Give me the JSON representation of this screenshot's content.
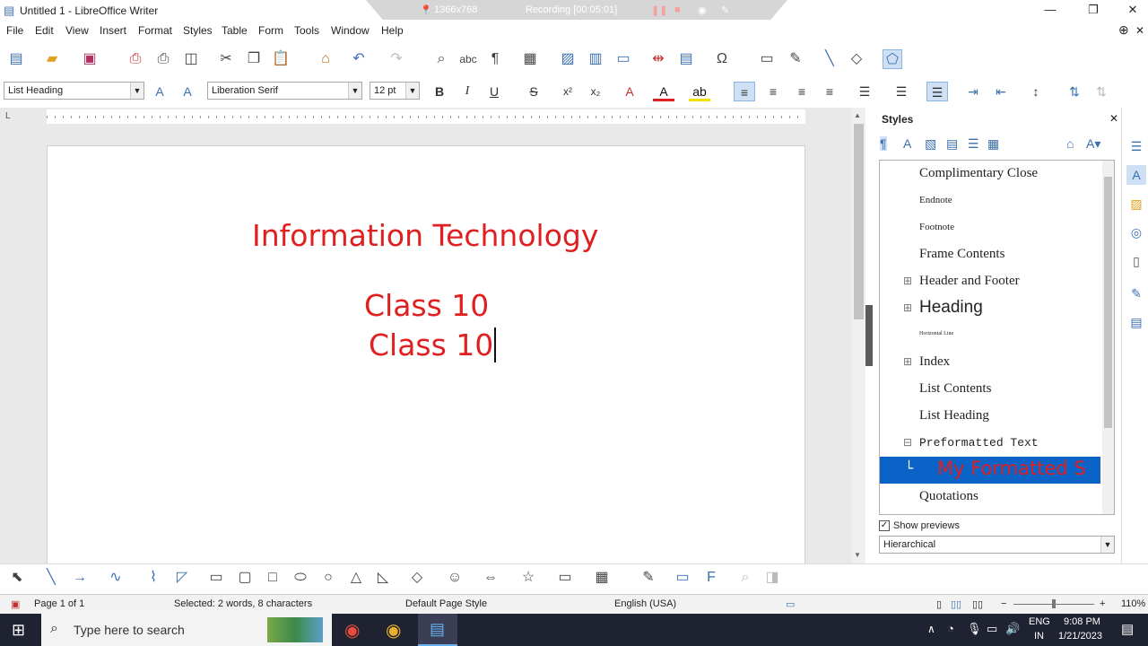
{
  "window": {
    "title": "Untitled 1 - LibreOffice Writer"
  },
  "recording": {
    "resolution": "1366x768",
    "status": "Recording [00:05:01]"
  },
  "menu": [
    "File",
    "Edit",
    "View",
    "Insert",
    "Format",
    "Styles",
    "Table",
    "Form",
    "Tools",
    "Window",
    "Help"
  ],
  "format": {
    "paragraph_style": "List Heading",
    "font_name": "Liberation Serif",
    "font_size": "12 pt"
  },
  "document": {
    "line1": "Information Technology",
    "line2": "Class 10",
    "line3": "Class 10",
    "text_color": "#e02020"
  },
  "sidebar": {
    "title": "Styles",
    "styles": [
      {
        "label": "Complimentary Close",
        "expander": ""
      },
      {
        "label": "Endnote",
        "expander": ""
      },
      {
        "label": "Footnote",
        "expander": ""
      },
      {
        "label": "Frame Contents",
        "expander": ""
      },
      {
        "label": "Header and Footer",
        "expander": "⊞"
      },
      {
        "label": "Heading",
        "expander": "⊞"
      },
      {
        "label": "Horizontal Line",
        "expander": ""
      },
      {
        "label": "Index",
        "expander": "⊞"
      },
      {
        "label": "List Contents",
        "expander": ""
      },
      {
        "label": "List Heading",
        "expander": ""
      },
      {
        "label": "Preformatted Text",
        "expander": "⊟"
      },
      {
        "label": "My Formatted S",
        "expander": "└"
      },
      {
        "label": "Quotations",
        "expander": ""
      }
    ],
    "selected_index": 11,
    "show_previews_label": "Show previews",
    "show_previews": true,
    "filter": "Hierarchical"
  },
  "status": {
    "page": "Page 1 of 1",
    "selection": "Selected: 2 words, 8 characters",
    "page_style": "Default Page Style",
    "language": "English (USA)",
    "zoom": "110%"
  },
  "taskbar": {
    "search_placeholder": "Type here to search",
    "lang1": "ENG",
    "lang2": "IN",
    "time": "9:08 PM",
    "date": "1/21/2023"
  },
  "colors": {
    "selection": "#0a64c8",
    "accent": "#3a6fb0",
    "taskbar": "#1f2230"
  }
}
